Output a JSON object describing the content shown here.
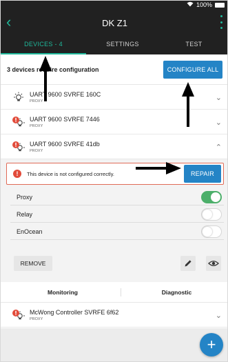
{
  "statusbar": {
    "battery": "100%"
  },
  "appbar": {
    "title": "DK Z1"
  },
  "tabs": [
    {
      "label": "DEVICES - 4"
    },
    {
      "label": "SETTINGS"
    },
    {
      "label": "TEST"
    }
  ],
  "summary": {
    "text": "3 devices require configuration",
    "configure_all_label": "CONFIGURE ALL"
  },
  "devices": [
    {
      "name": "UART 9600 SVRFE 160C",
      "type": "PROXY",
      "status": "ok"
    },
    {
      "name": "UART 9600 SVRFE 7446",
      "type": "PROXY",
      "status": "error"
    },
    {
      "name": "UART 9600 SVRFE 41db",
      "type": "PROXY",
      "status": "error",
      "expanded": true
    },
    {
      "name": "McWong Controller SVRFE 6f62",
      "type": "PROXY",
      "status": "error"
    }
  ],
  "expanded_device": {
    "warning_text": "This device is not configured correctly.",
    "repair_label": "REPAIR",
    "toggles": [
      {
        "label": "Proxy",
        "on": true
      },
      {
        "label": "Relay",
        "on": false
      },
      {
        "label": "EnOcean",
        "on": false
      }
    ],
    "remove_label": "REMOVE"
  },
  "subtabs": {
    "monitoring": "Monitoring",
    "diagnostic": "Diagnostic"
  },
  "fab": {
    "icon": "+"
  },
  "colors": {
    "accent": "#1fb89a",
    "primary_button": "#2484c6",
    "error": "#e24b3a",
    "toggle_on": "#4caf6a",
    "appbar": "#212121"
  }
}
